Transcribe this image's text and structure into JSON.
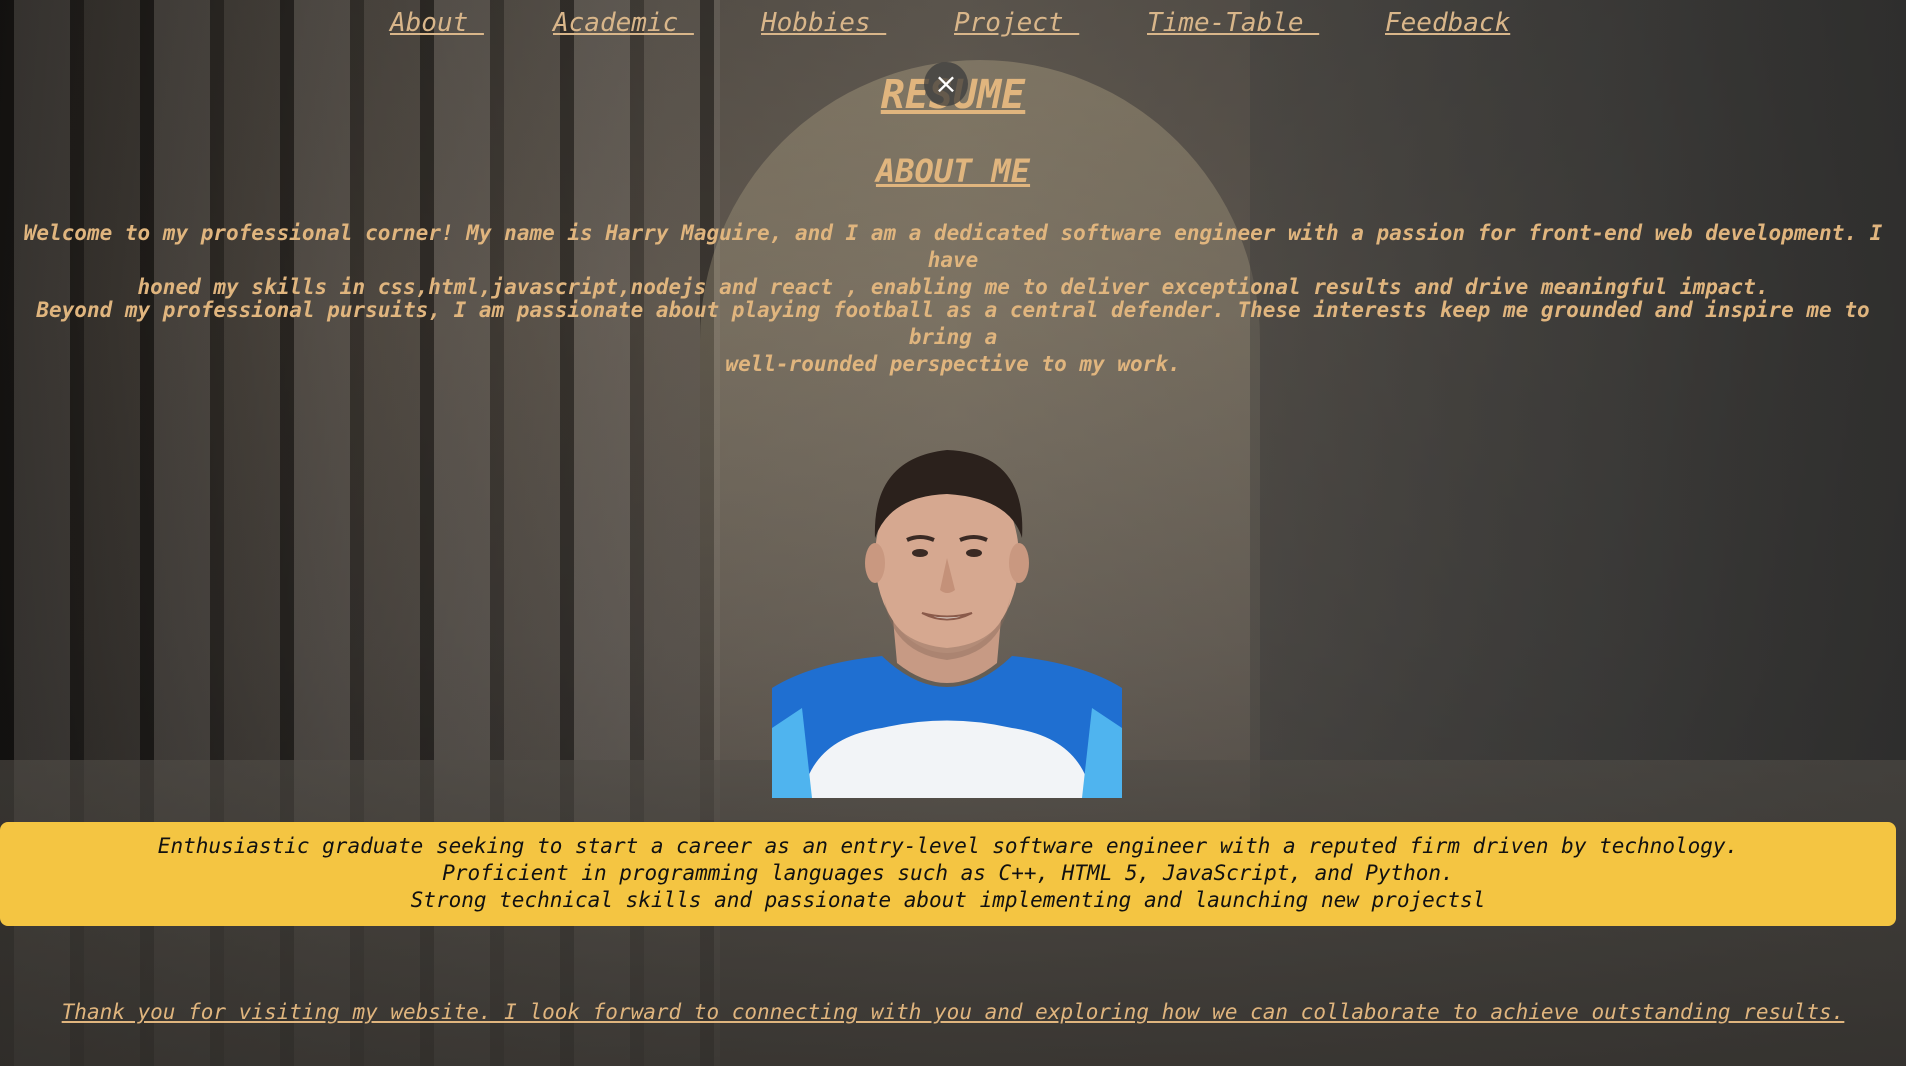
{
  "nav": {
    "items": [
      {
        "label": "About "
      },
      {
        "label": "Academic "
      },
      {
        "label": "Hobbies "
      },
      {
        "label": "Project "
      },
      {
        "label": "Time-Table "
      },
      {
        "label": "Feedback"
      }
    ]
  },
  "overlay": {
    "close_icon": "close-icon",
    "close_glyph": "×"
  },
  "header": {
    "title": "RESUME",
    "subtitle": "ABOUT ME"
  },
  "about": {
    "paragraph1_line1": "Welcome to my professional corner! My name is Harry Maguire, and I am a dedicated software engineer with a passion for front-end web development. I have",
    "paragraph1_line2": "honed my skills in css,html,javascript,nodejs and react , enabling me to deliver exceptional results and drive meaningful impact.",
    "paragraph2_line1": "Beyond my professional pursuits, I am passionate about playing football as a central defender. These interests keep me grounded and inspire me to bring a",
    "paragraph2_line2": "well-rounded perspective to my work."
  },
  "summary": {
    "line1": "Enthusiastic graduate seeking to start a career as an entry-level software engineer with a reputed firm driven by technology.",
    "line2": "Proficient in programming languages such as C++, HTML 5, JavaScript, and Python.",
    "line3": "Strong technical skills and passionate about implementing and launching new projectsl"
  },
  "footer": {
    "thanks": "Thank you for visiting my website. I look forward to connecting with you and exploring how we can collaborate to achieve outstanding results."
  },
  "colors": {
    "accent_text": "#e0b57e",
    "summary_bg": "#f4c542"
  }
}
